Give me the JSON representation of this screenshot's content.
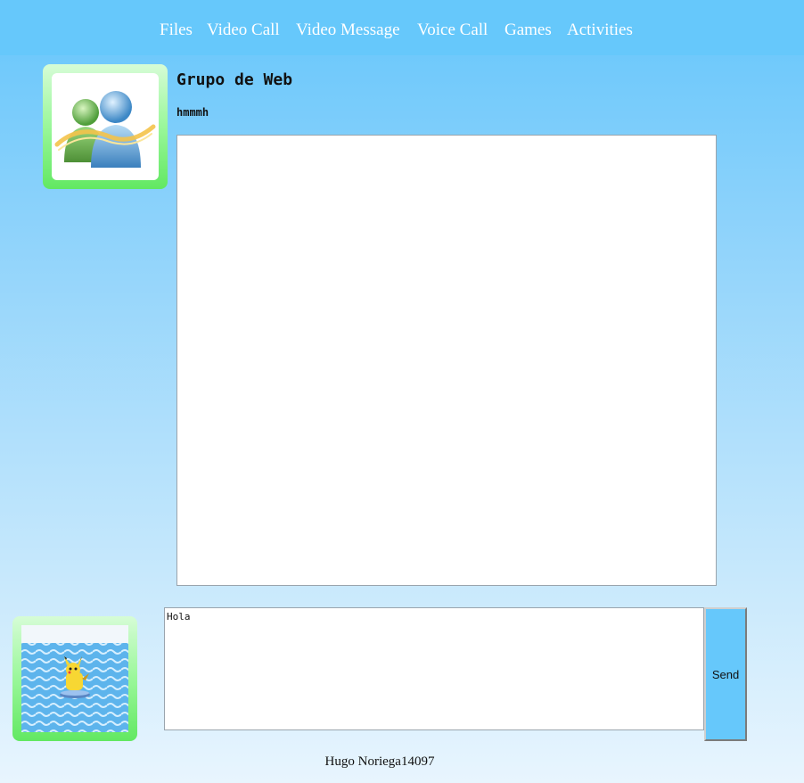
{
  "nav": {
    "items": [
      {
        "label": "Files",
        "icon": null
      },
      {
        "label": "Video Call"
      },
      {
        "label": "Video Message"
      },
      {
        "label": "Voice Call"
      },
      {
        "label": "Games"
      },
      {
        "label": "Activities"
      }
    ]
  },
  "chat": {
    "title": "Grupo de Web",
    "status": "hmmmh",
    "contact_avatar_icon": "messenger-buddies-icon",
    "user_avatar_icon": "pikachu-surfing-avatar"
  },
  "composer": {
    "message_value": "Hola",
    "send_label": "Send"
  },
  "footer": {
    "user_name": "Hugo Noriega14097"
  },
  "colors": {
    "nav_background": "#66c8fb",
    "send_button": "#66c8fb",
    "avatar_frame": "#62e862"
  }
}
